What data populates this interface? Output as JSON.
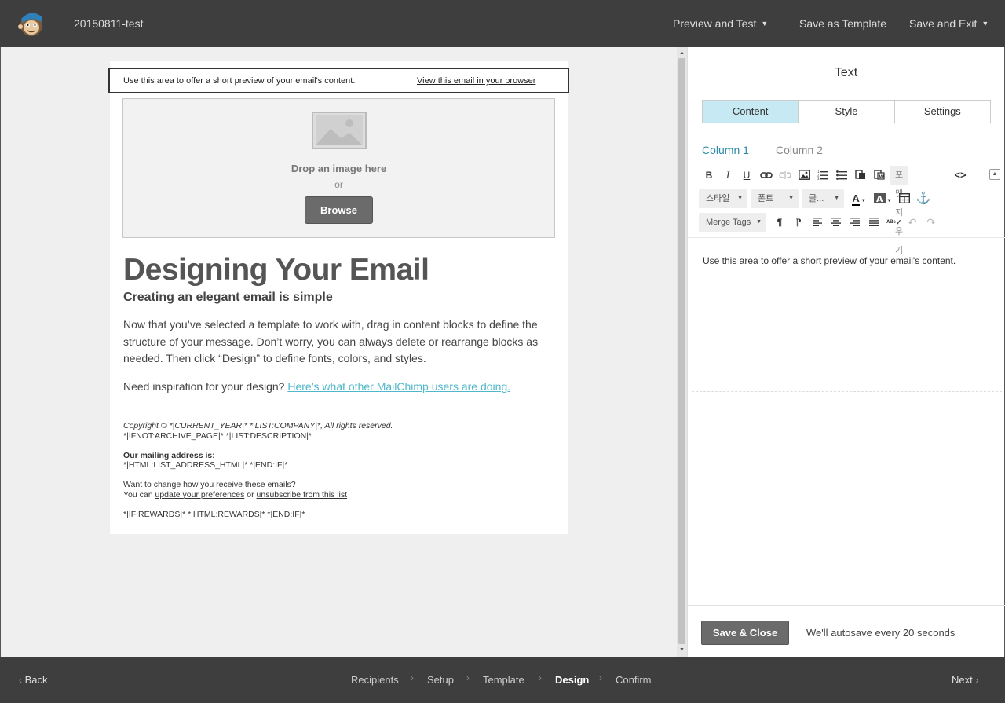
{
  "header": {
    "campaign_name": "20150811-test",
    "preview_and_test": "Preview and Test",
    "save_as_template": "Save as Template",
    "save_and_exit": "Save and Exit"
  },
  "email": {
    "preheader_text": "Use this area to offer a short preview of your email's content.",
    "preheader_link": "View this email in your browser",
    "drop_image_text": "Drop an image here",
    "drop_or": "or",
    "browse_label": "Browse",
    "heading": "Designing Your Email",
    "subheading": "Creating an elegant email is simple",
    "body_text": "Now that you’ve selected a template to work with, drag in content blocks to define the structure of your message. Don’t worry, you can always delete or rearrange blocks as needed. Then click “Design” to define fonts, colors, and styles.",
    "inspiration_text": "Need inspiration for your design?",
    "inspiration_link": "Here’s what other MailChimp users are doing.",
    "footer": {
      "copyright": "Copyright © *|CURRENT_YEAR|* *|LIST:COMPANY|*, All rights reserved.",
      "archive": "*|IFNOT:ARCHIVE_PAGE|* *|LIST:DESCRIPTION|*",
      "mailing_label": "Our mailing address is:",
      "mailing_value": "*|HTML:LIST_ADDRESS_HTML|* *|END:IF|*",
      "change_question": "Want to change how you receive these emails?",
      "you_can": "You can",
      "update_link": "update your preferences",
      "or": "or",
      "unsubscribe_link": "unsubscribe from this list",
      "rewards": "*|IF:REWARDS|* *|HTML:REWARDS|* *|END:IF|*"
    }
  },
  "panel": {
    "title": "Text",
    "tabs": [
      "Content",
      "Style",
      "Settings"
    ],
    "active_tab": "Content",
    "columns": [
      "Column 1",
      "Column 2"
    ],
    "toolbar": {
      "clear_format": "포맷 지우기",
      "style_dropdown": "스타일",
      "font_dropdown": "폰트",
      "size_dropdown": "글...",
      "merge_tags": "Merge Tags"
    },
    "editor_text": "Use this area to offer a short preview of your email's content.",
    "save_close": "Save & Close",
    "autosave_note": "We'll autosave every 20 seconds"
  },
  "footer_nav": {
    "back": "Back",
    "next": "Next",
    "steps": [
      "Recipients",
      "Setup",
      "Template",
      "Design",
      "Confirm"
    ],
    "current_step": "Design"
  },
  "colors": {
    "bar_bg": "#3e3e3e",
    "active_tab_bg": "#c7e9f3",
    "link_teal": "#4fb7c9",
    "button_gray": "#6b6b6b"
  }
}
